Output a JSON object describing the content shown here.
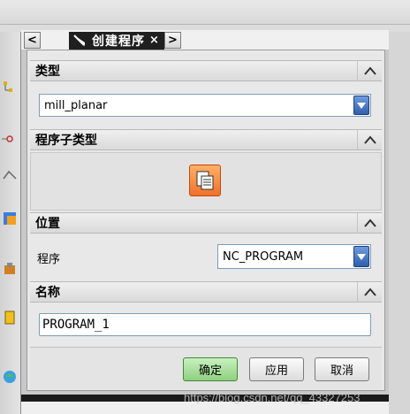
{
  "dialog": {
    "title": "创建程序",
    "nav_prev": "<",
    "nav_next": ">",
    "close": "×"
  },
  "sections": {
    "type": {
      "title": "类型",
      "value": "mill_planar"
    },
    "subtype": {
      "title": "程序子类型",
      "icon": "program-subtype-icon"
    },
    "location": {
      "title": "位置",
      "program_label": "程序",
      "program_value": "NC_PROGRAM"
    },
    "name": {
      "title": "名称",
      "value": "PROGRAM_1"
    }
  },
  "buttons": {
    "ok": "确定",
    "apply": "应用",
    "cancel": "取消"
  },
  "watermark": "https://blog.csdn.net/qq_43327253",
  "colors": {
    "ok_button": "#8fd07f",
    "dropdown_arrow": "#2f5fae",
    "subtype_icon": "#f0702a",
    "title_bar": "#1f1f1f"
  }
}
